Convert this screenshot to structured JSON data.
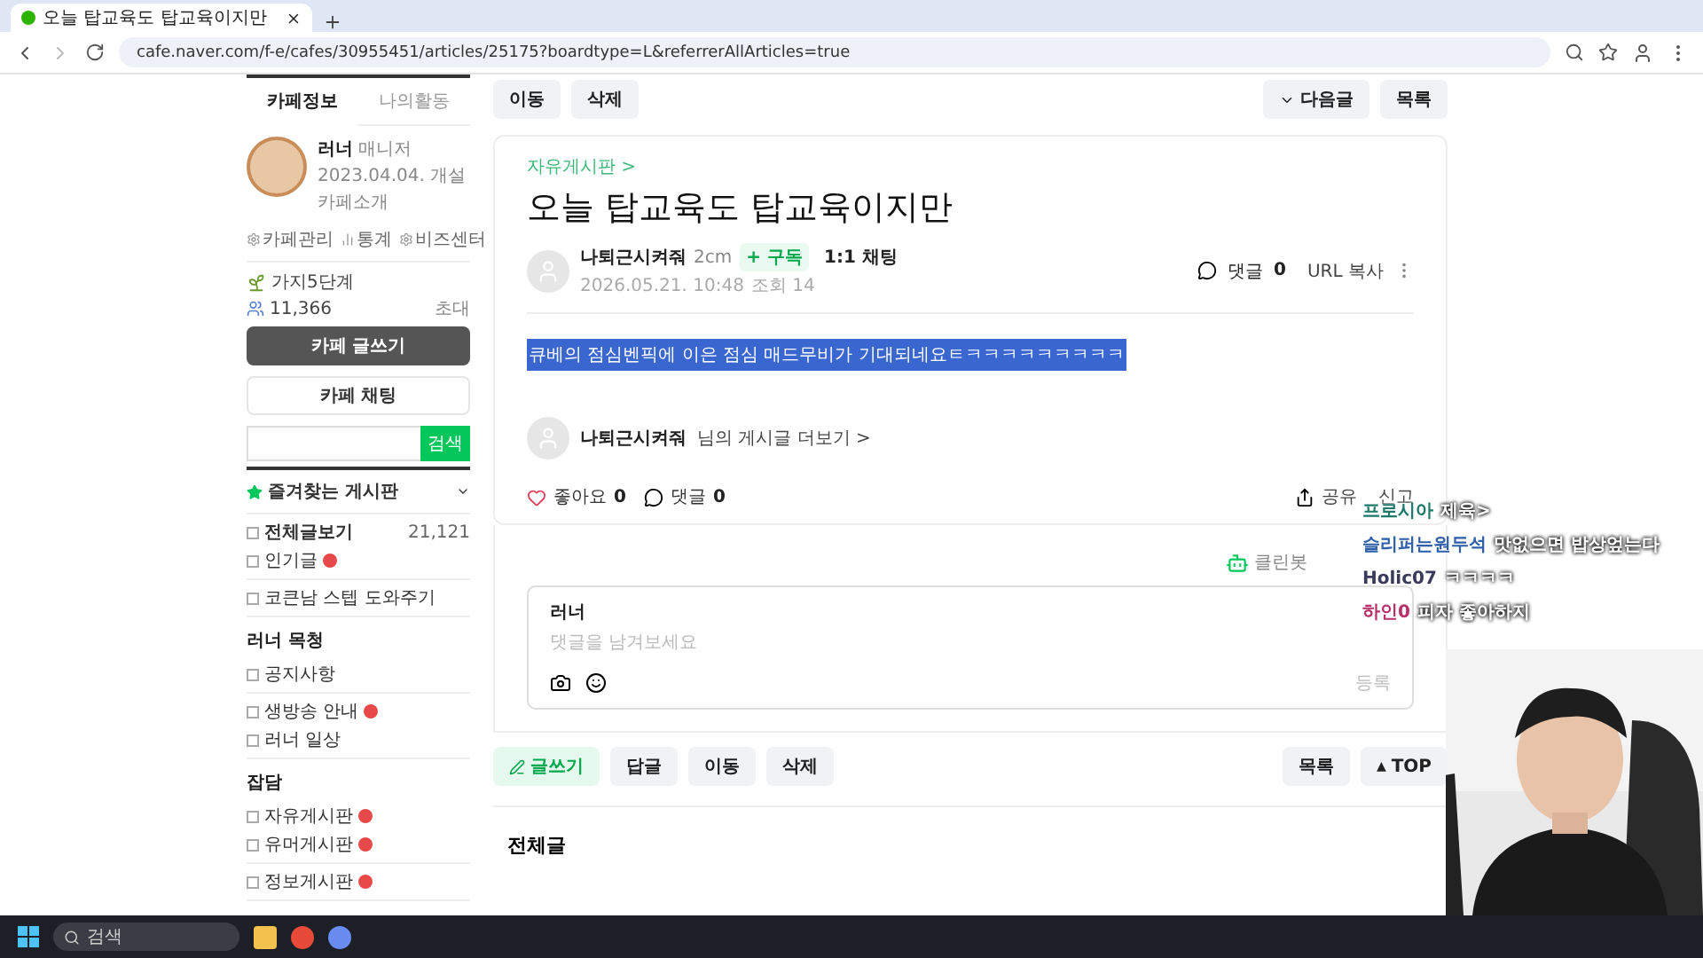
{
  "browser": {
    "tab_title": "오늘 탑교육도 탑교육이지만",
    "url": "cafe.naver.com/f-e/cafes/30955451/articles/25175?boardtype=L&referrerAllArticles=true"
  },
  "sidebar": {
    "tabs": [
      {
        "label": "카페정보",
        "selected": true
      },
      {
        "label": "나의활동",
        "selected": false
      }
    ],
    "cafe": {
      "name": "러너",
      "role": "매니저",
      "founded": "2023.04.04. 개설",
      "intro": "카페소개"
    },
    "admin_links": [
      "카페관리",
      "통계",
      "비즈센터"
    ],
    "level": "가지5단계",
    "members": "11,366",
    "invite": "초대",
    "write_button": "카페 글쓰기",
    "chat_button": "카페 채팅",
    "search_button": "검색",
    "favorites": "즐겨찾는 게시판",
    "menu_groups": [
      {
        "items": [
          {
            "label": "전체글보기",
            "count": "21,121",
            "bold": true,
            "new": false
          },
          {
            "label": "인기글",
            "bold": false,
            "new": true
          }
        ]
      },
      {
        "items": [
          {
            "label": "코큰남 스텝 도와주기",
            "bold": false,
            "new": false
          }
        ]
      },
      {
        "heading": "러너 목청",
        "items": [
          {
            "label": "공지사항",
            "bold": false,
            "new": false
          }
        ]
      },
      {
        "items": [
          {
            "label": "생방송 안내",
            "bold": false,
            "new": true
          },
          {
            "label": "러너 일상",
            "bold": false,
            "new": false
          }
        ]
      },
      {
        "heading": "잡담",
        "items": [
          {
            "label": "자유게시판",
            "bold": false,
            "new": true
          },
          {
            "label": "유머게시판",
            "bold": false,
            "new": true
          }
        ]
      },
      {
        "items": [
          {
            "label": "정보게시판",
            "bold": false,
            "new": true
          }
        ]
      }
    ]
  },
  "top_toolbar": {
    "left": [
      "이동",
      "삭제"
    ],
    "next": "다음글",
    "list": "목록"
  },
  "article": {
    "board": "자유게시판 >",
    "title": "오늘 탑교육도 탑교육이지만",
    "author": "나퇴근시켜줘",
    "author_level": "2cm",
    "subscribe": "+ 구독",
    "chat": "1:1 채팅",
    "date": "2026.05.21. 10:48",
    "views": "조회 14",
    "comments_label": "댓글",
    "comments_count": "0",
    "url_copy": "URL 복사",
    "body": "큐베의 점심벤픽에 이은 점심 매드무비가 기대되네요ㅌㅋㅋㅋㅋㅋㅋㅋㅋㅋ",
    "body_selected": true,
    "more_author": "나퇴근시켜줘",
    "more_text": "님의 게시글 더보기 >",
    "likes_label": "좋아요",
    "likes_count": "0",
    "comments2_label": "댓글",
    "comments2_count": "0",
    "share": "공유",
    "report": "신고",
    "cleanbot": "클린봇"
  },
  "comment_box": {
    "user": "러너",
    "placeholder": "댓글을 남겨보세요",
    "submit": "등록"
  },
  "bottom_toolbar": [
    {
      "label": "글쓰기",
      "kind": "primary"
    },
    {
      "label": "답글",
      "kind": "plain"
    },
    {
      "label": "이동",
      "kind": "plain"
    },
    {
      "label": "삭제",
      "kind": "plain"
    },
    {
      "label": "목록",
      "kind": "right"
    },
    {
      "label": "TOP",
      "icon": "▲",
      "kind": "top"
    }
  ],
  "section_title": "전체글",
  "chat": [
    {
      "user": "프로시아",
      "message": "제육>",
      "color": "#1f7a6a"
    },
    {
      "user": "슬리퍼는원두석",
      "message": "맛없으면 밥상엎는다",
      "color": "#2f5fa8"
    },
    {
      "user": "Holic07",
      "message": "ㅋㅋㅋㅋ",
      "color": "#3a3a5a"
    },
    {
      "user": "하인0",
      "message": "피자 좋아하지",
      "color": "#b8306a"
    }
  ],
  "taskbar": {
    "search_placeholder": "검색"
  }
}
